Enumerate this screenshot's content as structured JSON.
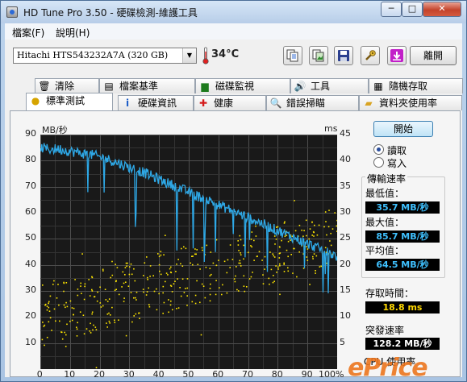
{
  "window": {
    "title": "HD Tune Pro 3.50 - 硬碟檢測-維護工具",
    "min_label": "─",
    "max_label": "□",
    "close_label": "✕"
  },
  "menu": {
    "file": "檔案(F)",
    "help": "說明(H)"
  },
  "toolbar": {
    "drive": "Hitachi HTS543232A7A (320 GB)",
    "temperature": "34°C",
    "exit_label": "離開",
    "icons": [
      "copy-text-icon",
      "copy-screenshot-icon",
      "save-icon",
      "options-icon",
      "download-icon"
    ]
  },
  "tabs": {
    "top": [
      {
        "icon": "trash-icon",
        "label": "清除"
      },
      {
        "icon": "file-benchmark-icon",
        "label": "檔案基準"
      },
      {
        "icon": "disk-monitor-icon",
        "label": "磁碟監視"
      },
      {
        "icon": "tools-icon",
        "label": "工具"
      },
      {
        "icon": "random-access-icon",
        "label": "隨機存取"
      }
    ],
    "bottom": [
      {
        "icon": "benchmark-icon",
        "label": "標準測試",
        "active": true
      },
      {
        "icon": "info-icon",
        "label": "硬碟資訊"
      },
      {
        "icon": "health-icon",
        "label": "健康"
      },
      {
        "icon": "error-scan-icon",
        "label": "錯誤掃瞄"
      },
      {
        "icon": "folder-usage-icon",
        "label": "資料夾使用率"
      }
    ]
  },
  "chart_data": {
    "type": "line",
    "left_axis_label": "MB/秒",
    "right_axis_label": "ms",
    "left_ticks": [
      "90",
      "80",
      "70",
      "60",
      "50",
      "40",
      "30",
      "20",
      "10"
    ],
    "right_ticks": [
      "45",
      "40",
      "35",
      "30",
      "25",
      "20",
      "15",
      "10",
      "5"
    ],
    "x_ticks": [
      "0",
      "10",
      "20",
      "30",
      "40",
      "50",
      "60",
      "70",
      "80",
      "90",
      "100%"
    ],
    "ylim_left": [
      0,
      90
    ],
    "ylim_right": [
      0,
      45
    ],
    "xlim": [
      0,
      100
    ],
    "grid": true,
    "series": [
      {
        "name": "傳輸速率",
        "color": "#2ea8e6",
        "axis": "left",
        "x": [
          0,
          2,
          4,
          6,
          8,
          10,
          12,
          14,
          16,
          18,
          20,
          22,
          24,
          26,
          28,
          30,
          32,
          34,
          36,
          38,
          40,
          42,
          44,
          46,
          48,
          50,
          52,
          54,
          56,
          58,
          60,
          62,
          64,
          66,
          68,
          70,
          72,
          74,
          76,
          78,
          80,
          82,
          84,
          86,
          88,
          90,
          92,
          94,
          96,
          98,
          100
        ],
        "values": [
          85.0,
          84.6,
          84.3,
          84.5,
          84.1,
          83.6,
          83.2,
          82.8,
          82.5,
          82.1,
          81.4,
          80.8,
          80.0,
          79.1,
          78.3,
          77.4,
          76.6,
          75.8,
          74.9,
          73.8,
          72.9,
          71.8,
          70.9,
          69.8,
          68.9,
          67.9,
          66.8,
          66.0,
          65.1,
          64.1,
          63.0,
          62.1,
          61.2,
          60.1,
          59.1,
          58.2,
          57.2,
          56.2,
          55.2,
          54.1,
          53.1,
          52.2,
          51.1,
          50.2,
          49.0,
          48.1,
          47.2,
          46.1,
          45.2,
          44.2,
          43.3
        ]
      },
      {
        "name": "存取時間",
        "color": "#ffe600",
        "axis": "right",
        "type": "scatter",
        "spread": [
          [
            0,
            10.5
          ],
          [
            100,
            25.5
          ]
        ]
      }
    ]
  },
  "side": {
    "start_label": "開始",
    "read_label": "讀取",
    "write_label": "寫入",
    "read_checked": true,
    "transfer_title": "傳輸速率",
    "min_label": "最低值：",
    "min_value": "35.7 MB/秒",
    "max_label": "最大值：",
    "max_value": "85.7 MB/秒",
    "avg_label": "平均值：",
    "avg_value": "64.5 MB/秒",
    "access_label": "存取時間：",
    "access_value": "18.8 ms",
    "burst_label": "突發速率",
    "burst_value": "128.2 MB/秒",
    "cpu_label": "CPU 使用率"
  },
  "watermark": "ePrice",
  "colors": {
    "transfer_line": "#2ea8e6",
    "access_points": "#ffe600",
    "plot_background": "#191919",
    "value_box": "#000000"
  }
}
